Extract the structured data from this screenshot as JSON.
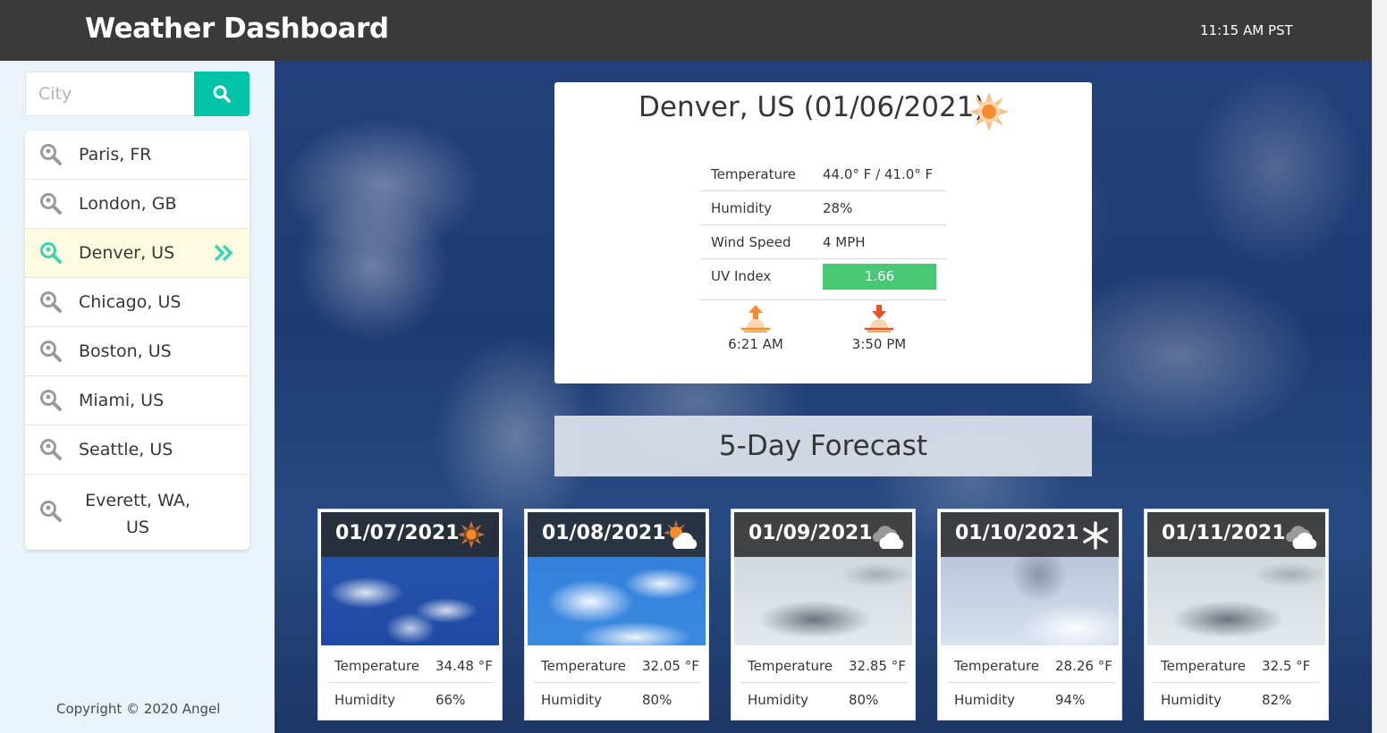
{
  "header": {
    "title": "Weather Dashboard",
    "time": "11:15 AM PST"
  },
  "search": {
    "placeholder": "City"
  },
  "history": [
    {
      "label": "Paris, FR"
    },
    {
      "label": "London, GB"
    },
    {
      "label": "Denver, US",
      "active": true
    },
    {
      "label": "Chicago, US"
    },
    {
      "label": "Boston, US"
    },
    {
      "label": "Miami, US"
    },
    {
      "label": "Seattle, US"
    },
    {
      "label_line1": "Everett, WA,",
      "label_line2": "US"
    }
  ],
  "footer": {
    "copyright": "Copyright © 2020 Angel"
  },
  "current": {
    "heading": "Denver, US (01/06/2021)",
    "icon": "sun-icon",
    "rows": [
      {
        "key": "Temperature",
        "value": "44.0° F / 41.0° F"
      },
      {
        "key": "Humidity",
        "value": "28%"
      },
      {
        "key": "Wind Speed",
        "value": "4 MPH"
      },
      {
        "key": "UV Index",
        "value": "1.66"
      }
    ],
    "sunrise": "6:21 AM",
    "sunset": "3:50 PM"
  },
  "forecast_title": "5-Day Forecast",
  "forecast": [
    {
      "date": "01/07/2021",
      "icon": "sun-icon",
      "temp_label": "Temperature",
      "temp": "34.48 °F",
      "hum_label": "Humidity",
      "hum": "66%"
    },
    {
      "date": "01/08/2021",
      "icon": "partly-cloudy-icon",
      "temp_label": "Temperature",
      "temp": "32.05 °F",
      "hum_label": "Humidity",
      "hum": "80%"
    },
    {
      "date": "01/09/2021",
      "icon": "cloud-icon",
      "temp_label": "Temperature",
      "temp": "32.85 °F",
      "hum_label": "Humidity",
      "hum": "80%"
    },
    {
      "date": "01/10/2021",
      "icon": "snowflake-icon",
      "temp_label": "Temperature",
      "temp": "28.26 °F",
      "hum_label": "Humidity",
      "hum": "94%"
    },
    {
      "date": "01/11/2021",
      "icon": "cloud-icon",
      "temp_label": "Temperature",
      "temp": "32.5 °F",
      "hum_label": "Humidity",
      "hum": "82%"
    }
  ],
  "colors": {
    "header_bg": "#3a3a3a",
    "accent": "#00c4a7",
    "uv_good": "#48c774",
    "active_row": "#fefce0"
  }
}
